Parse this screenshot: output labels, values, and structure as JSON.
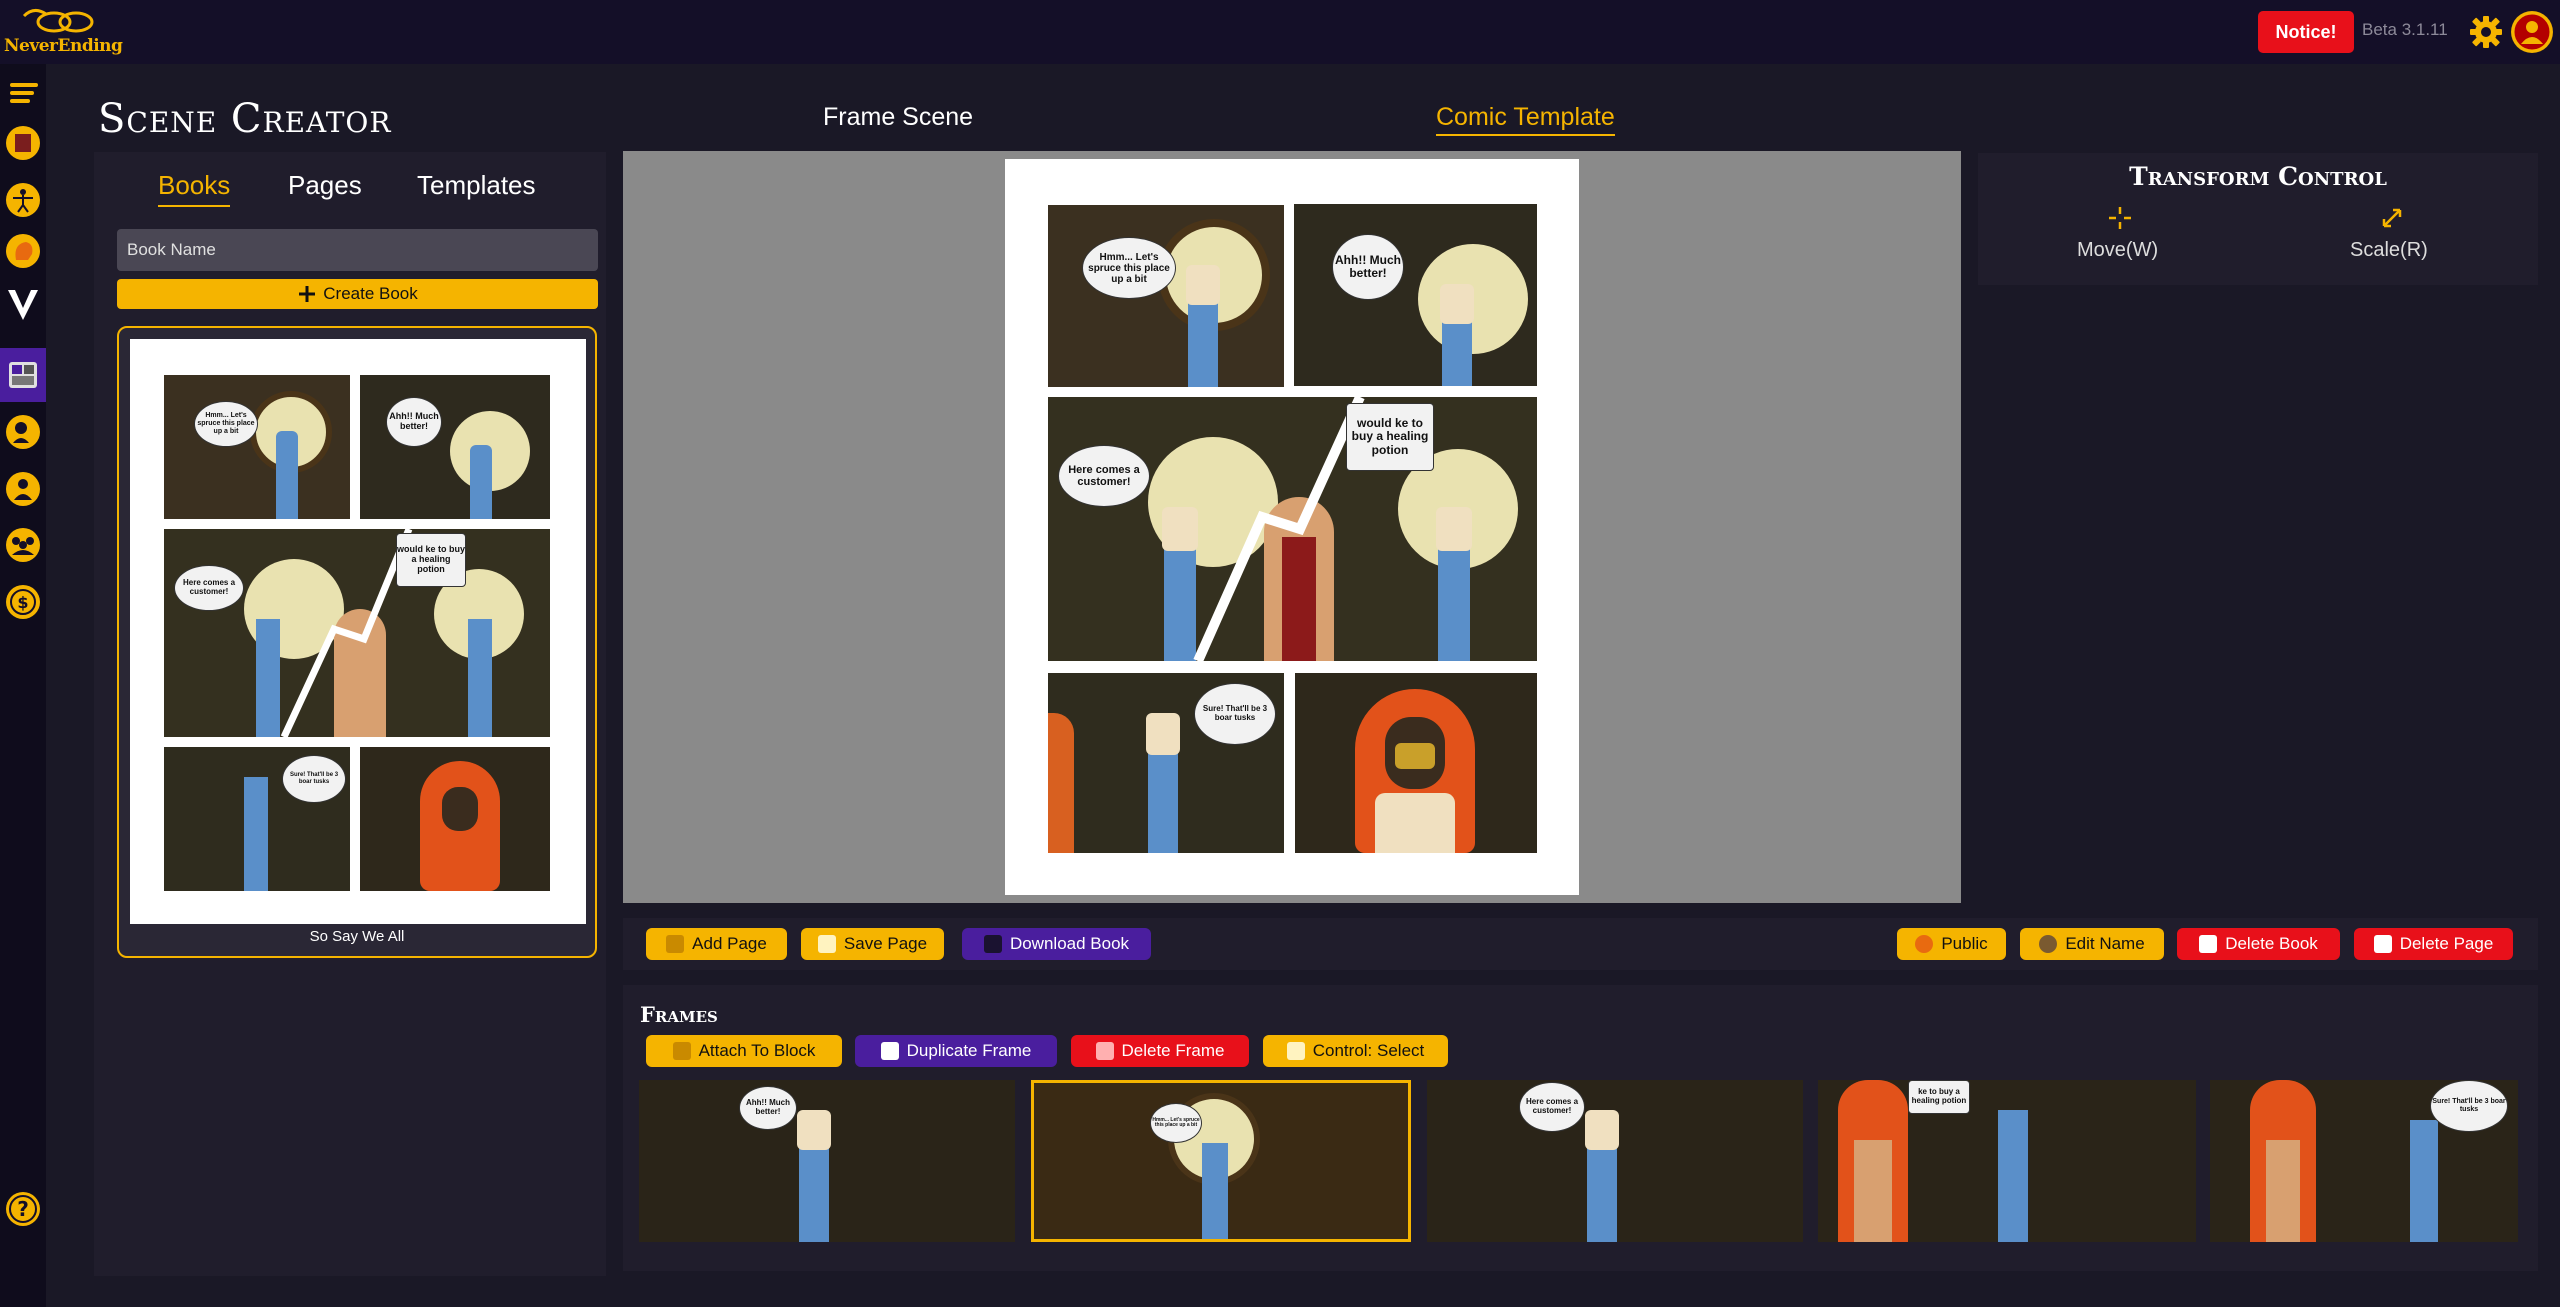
{
  "app": {
    "logo_text": "NeverEnding",
    "notice_label": "Notice!",
    "version": "Beta 3.1.11"
  },
  "header": {
    "title": "Scene Creator",
    "tabs": [
      {
        "label": "Frame Scene",
        "active": false
      },
      {
        "label": "Comic Template",
        "active": true
      }
    ]
  },
  "sidebar": {
    "icons": [
      "menu-icon",
      "book-icon",
      "body-icon",
      "head-icon",
      "v-icon",
      "comic-icon",
      "character-icon",
      "person-icon",
      "group-icon",
      "coin-icon",
      "help-icon"
    ],
    "active": "comic-icon"
  },
  "left_panel": {
    "tabs": [
      {
        "label": "Books",
        "active": true
      },
      {
        "label": "Pages",
        "active": false
      },
      {
        "label": "Templates",
        "active": false
      }
    ],
    "book_name_placeholder": "Book Name",
    "create_book_label": "Create Book",
    "book_card_title": "So Say We All"
  },
  "comic_page": {
    "bubbles": {
      "p1": "Hmm... Let's spruce this place up a bit",
      "p2": "Ahh!! Much better!",
      "p3_left": "Here comes a customer!",
      "p3_right": "would ke to buy a healing potion",
      "p4": "Sure! That'll be 3 boar tusks"
    }
  },
  "transform": {
    "title": "Transform Control",
    "move_label": "Move(W)",
    "scale_label": "Scale(R)"
  },
  "toolbar": {
    "add_page": "Add Page",
    "save_page": "Save Page",
    "download_book": "Download Book",
    "public": "Public",
    "edit_name": "Edit Name",
    "delete_book": "Delete Book",
    "delete_page": "Delete Page"
  },
  "frames": {
    "title": "Frames",
    "attach_to_block": "Attach To Block",
    "duplicate_frame": "Duplicate Frame",
    "delete_frame": "Delete Frame",
    "control_select": "Control: Select",
    "items": [
      {
        "bubble": "Ahh!! Much better!",
        "selected": false
      },
      {
        "bubble": "Hmm... Let's spruce this place up a bit",
        "selected": true
      },
      {
        "bubble": "Here comes a customer!",
        "selected": false
      },
      {
        "bubble": "ke to buy a healing potion",
        "selected": false
      },
      {
        "bubble": "Sure! That'll be 3 boar tusks",
        "selected": false
      }
    ]
  },
  "colors": {
    "accent": "#f5b400",
    "danger": "#e8101a",
    "purple": "#4a1e9e",
    "topbar": "#140f28"
  }
}
